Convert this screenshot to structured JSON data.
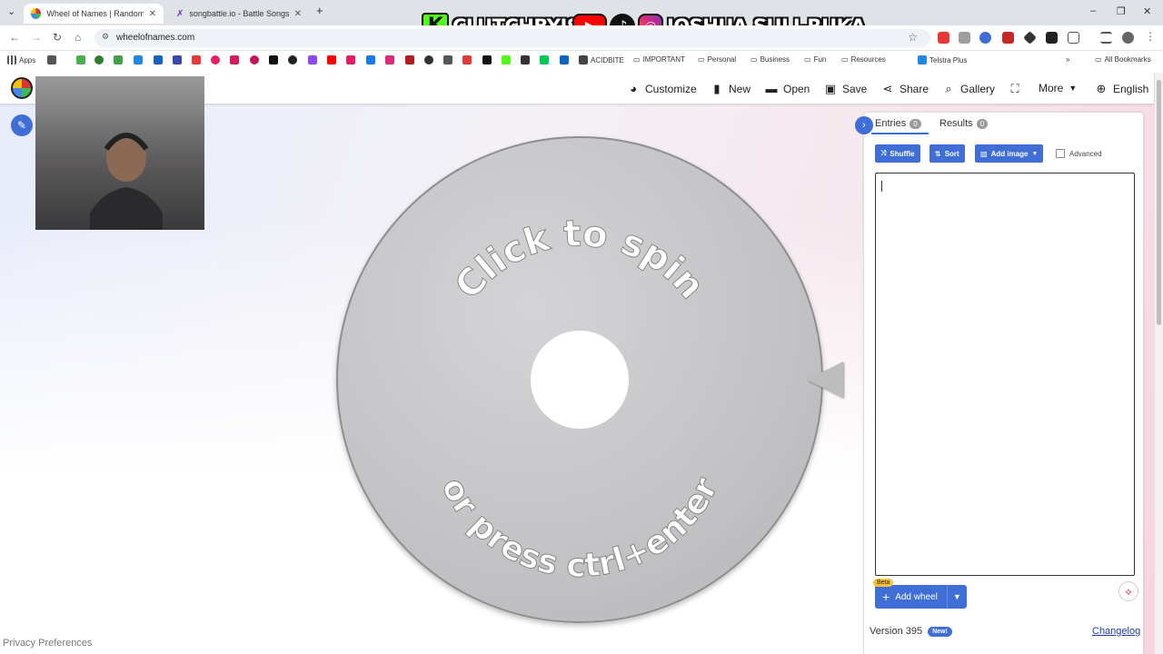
{
  "browser": {
    "tabs": [
      {
        "title": "Wheel of Names | Random nam",
        "active": true
      },
      {
        "title": "songbattle.io - Battle Songs ag",
        "active": false
      }
    ],
    "url": "wheelofnames.com",
    "bookmarks": {
      "apps": "Apps",
      "acidbite": "ACIDBITE",
      "important": "IMPORTANT",
      "personal": "Personal",
      "business": "Business",
      "fun": "Fun",
      "resources": "Resources",
      "telstra": "Telstra Plus",
      "all": "All Bookmarks"
    }
  },
  "overlay": {
    "left_handle": "CLUTCHBYJSR",
    "right_handle": "JOSHUA SULI-RUKA"
  },
  "nav": {
    "customize": "Customize",
    "new": "New",
    "open": "Open",
    "save": "Save",
    "share": "Share",
    "gallery": "Gallery",
    "more": "More",
    "language": "English"
  },
  "wheel": {
    "top_text": "Click to spin",
    "bottom_text": "or press ctrl+enter"
  },
  "footer": {
    "privacy": "Privacy Preferences"
  },
  "panel": {
    "tabs": {
      "entries_label": "Entries",
      "entries_count": "0",
      "results_label": "Results",
      "results_count": "0"
    },
    "buttons": {
      "shuffle": "Shuffle",
      "sort": "Sort",
      "add_image": "Add image",
      "advanced": "Advanced"
    },
    "entries_value": "",
    "add_wheel": "Add wheel",
    "beta": "Beta",
    "version": "Version 395",
    "new_badge": "New!",
    "changelog": "Changelog"
  },
  "colors": {
    "accent": "#3f6fd6",
    "wheel": "#c4c4c6"
  }
}
